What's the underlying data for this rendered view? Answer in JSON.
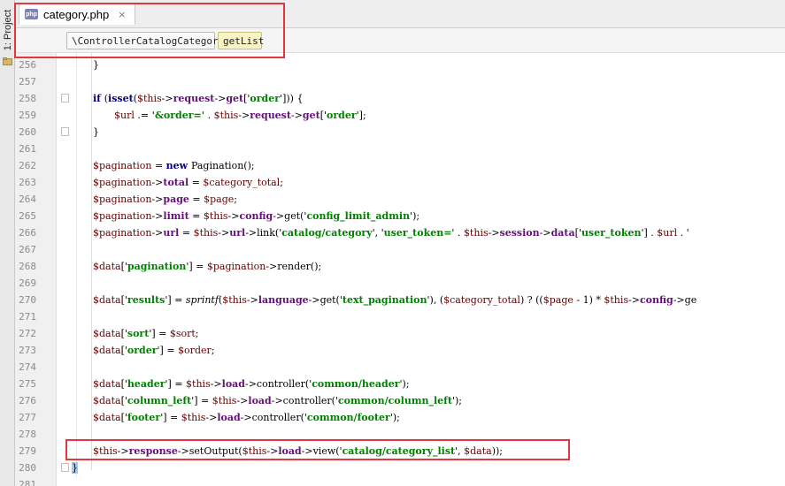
{
  "sidebar": {
    "tool_window_label": "1: Project"
  },
  "tab": {
    "filename": "category.php",
    "icon_text": "php",
    "close_glyph": "×"
  },
  "breadcrumb": {
    "class": "\\ControllerCatalogCategory",
    "method": "getList"
  },
  "editor": {
    "lines": [
      {
        "n": "256",
        "indent": 4,
        "tokens": [
          [
            "p",
            "}"
          ]
        ]
      },
      {
        "n": "257",
        "indent": 0,
        "tokens": []
      },
      {
        "n": "258",
        "indent": 4,
        "tokens": [
          [
            "kw",
            "if "
          ],
          [
            "p",
            "("
          ],
          [
            "kw",
            "isset"
          ],
          [
            "p",
            "("
          ],
          [
            "var",
            "$this"
          ],
          [
            "p",
            "->"
          ],
          [
            "prop",
            "request"
          ],
          [
            "p",
            "->"
          ],
          [
            "prop",
            "get"
          ],
          [
            "p",
            "['"
          ],
          [
            "str",
            "order"
          ],
          [
            "p",
            "'])) {"
          ]
        ]
      },
      {
        "n": "259",
        "indent": 8,
        "tokens": [
          [
            "var",
            "$url"
          ],
          [
            "p",
            " .= "
          ],
          [
            "str",
            "'&order='"
          ],
          [
            "p",
            " . "
          ],
          [
            "var",
            "$this"
          ],
          [
            "p",
            "->"
          ],
          [
            "prop",
            "request"
          ],
          [
            "p",
            "->"
          ],
          [
            "prop",
            "get"
          ],
          [
            "p",
            "['"
          ],
          [
            "str",
            "order"
          ],
          [
            "p",
            "'];"
          ]
        ]
      },
      {
        "n": "260",
        "indent": 4,
        "tokens": [
          [
            "p",
            "}"
          ]
        ]
      },
      {
        "n": "261",
        "indent": 0,
        "tokens": []
      },
      {
        "n": "262",
        "indent": 4,
        "tokens": [
          [
            "var",
            "$pagination"
          ],
          [
            "p",
            " = "
          ],
          [
            "kw",
            "new "
          ],
          [
            "p",
            "Pagination();"
          ]
        ]
      },
      {
        "n": "263",
        "indent": 4,
        "tokens": [
          [
            "var",
            "$pagination"
          ],
          [
            "p",
            "->"
          ],
          [
            "prop",
            "total"
          ],
          [
            "p",
            " = "
          ],
          [
            "var",
            "$category_total"
          ],
          [
            "p",
            ";"
          ]
        ]
      },
      {
        "n": "264",
        "indent": 4,
        "tokens": [
          [
            "var",
            "$pagination"
          ],
          [
            "p",
            "->"
          ],
          [
            "prop",
            "page"
          ],
          [
            "p",
            " = "
          ],
          [
            "var",
            "$page"
          ],
          [
            "p",
            ";"
          ]
        ]
      },
      {
        "n": "265",
        "indent": 4,
        "tokens": [
          [
            "var",
            "$pagination"
          ],
          [
            "p",
            "->"
          ],
          [
            "prop",
            "limit"
          ],
          [
            "p",
            " = "
          ],
          [
            "var",
            "$this"
          ],
          [
            "p",
            "->"
          ],
          [
            "prop",
            "config"
          ],
          [
            "p",
            "->get('"
          ],
          [
            "str",
            "config_limit_admin"
          ],
          [
            "p",
            "');"
          ]
        ]
      },
      {
        "n": "266",
        "indent": 4,
        "tokens": [
          [
            "var",
            "$pagination"
          ],
          [
            "p",
            "->"
          ],
          [
            "prop",
            "url"
          ],
          [
            "p",
            " = "
          ],
          [
            "var",
            "$this"
          ],
          [
            "p",
            "->"
          ],
          [
            "prop",
            "url"
          ],
          [
            "p",
            "->link('"
          ],
          [
            "str",
            "catalog/category"
          ],
          [
            "p",
            "', '"
          ],
          [
            "str",
            "user_token="
          ],
          [
            "p",
            "' . "
          ],
          [
            "var",
            "$this"
          ],
          [
            "p",
            "->"
          ],
          [
            "prop",
            "session"
          ],
          [
            "p",
            "->"
          ],
          [
            "prop",
            "data"
          ],
          [
            "p",
            "['"
          ],
          [
            "str",
            "user_token"
          ],
          [
            "p",
            "'] . "
          ],
          [
            "var",
            "$url"
          ],
          [
            "p",
            " . '"
          ]
        ]
      },
      {
        "n": "267",
        "indent": 0,
        "tokens": []
      },
      {
        "n": "268",
        "indent": 4,
        "tokens": [
          [
            "var",
            "$data"
          ],
          [
            "p",
            "['"
          ],
          [
            "str",
            "pagination"
          ],
          [
            "p",
            "'] = "
          ],
          [
            "var",
            "$pagination"
          ],
          [
            "p",
            "->render();"
          ]
        ]
      },
      {
        "n": "269",
        "indent": 0,
        "tokens": []
      },
      {
        "n": "270",
        "indent": 4,
        "tokens": [
          [
            "var",
            "$data"
          ],
          [
            "p",
            "['"
          ],
          [
            "str",
            "results"
          ],
          [
            "p",
            "'] = "
          ],
          [
            "it",
            "sprintf"
          ],
          [
            "p",
            "("
          ],
          [
            "var",
            "$this"
          ],
          [
            "p",
            "->"
          ],
          [
            "prop",
            "language"
          ],
          [
            "p",
            "->get('"
          ],
          [
            "str",
            "text_pagination"
          ],
          [
            "p",
            "'), ("
          ],
          [
            "var",
            "$category_total"
          ],
          [
            "p",
            ") ? (("
          ],
          [
            "var",
            "$page"
          ],
          [
            "p",
            " - 1) * "
          ],
          [
            "var",
            "$this"
          ],
          [
            "p",
            "->"
          ],
          [
            "prop",
            "config"
          ],
          [
            "p",
            "->ge"
          ]
        ]
      },
      {
        "n": "271",
        "indent": 0,
        "tokens": []
      },
      {
        "n": "272",
        "indent": 4,
        "tokens": [
          [
            "var",
            "$data"
          ],
          [
            "p",
            "['"
          ],
          [
            "str",
            "sort"
          ],
          [
            "p",
            "'] = "
          ],
          [
            "var",
            "$sort"
          ],
          [
            "p",
            ";"
          ]
        ]
      },
      {
        "n": "273",
        "indent": 4,
        "tokens": [
          [
            "var",
            "$data"
          ],
          [
            "p",
            "['"
          ],
          [
            "str",
            "order"
          ],
          [
            "p",
            "'] = "
          ],
          [
            "var",
            "$order"
          ],
          [
            "p",
            ";"
          ]
        ]
      },
      {
        "n": "274",
        "indent": 0,
        "tokens": []
      },
      {
        "n": "275",
        "indent": 4,
        "tokens": [
          [
            "var",
            "$data"
          ],
          [
            "p",
            "['"
          ],
          [
            "str",
            "header"
          ],
          [
            "p",
            "'] = "
          ],
          [
            "var",
            "$this"
          ],
          [
            "p",
            "->"
          ],
          [
            "prop",
            "load"
          ],
          [
            "p",
            "->controller('"
          ],
          [
            "str",
            "common/header"
          ],
          [
            "p",
            "');"
          ]
        ]
      },
      {
        "n": "276",
        "indent": 4,
        "tokens": [
          [
            "var",
            "$data"
          ],
          [
            "p",
            "['"
          ],
          [
            "str",
            "column_left"
          ],
          [
            "p",
            "'] = "
          ],
          [
            "var",
            "$this"
          ],
          [
            "p",
            "->"
          ],
          [
            "prop",
            "load"
          ],
          [
            "p",
            "->controller('"
          ],
          [
            "str",
            "common/column_left"
          ],
          [
            "p",
            "');"
          ]
        ]
      },
      {
        "n": "277",
        "indent": 4,
        "tokens": [
          [
            "var",
            "$data"
          ],
          [
            "p",
            "['"
          ],
          [
            "str",
            "footer"
          ],
          [
            "p",
            "'] = "
          ],
          [
            "var",
            "$this"
          ],
          [
            "p",
            "->"
          ],
          [
            "prop",
            "load"
          ],
          [
            "p",
            "->controller('"
          ],
          [
            "str",
            "common/footer"
          ],
          [
            "p",
            "');"
          ]
        ]
      },
      {
        "n": "278",
        "indent": 0,
        "tokens": []
      },
      {
        "n": "279",
        "indent": 4,
        "tokens": [
          [
            "var",
            "$this"
          ],
          [
            "p",
            "->"
          ],
          [
            "prop",
            "response"
          ],
          [
            "p",
            "->setOutput("
          ],
          [
            "var",
            "$this"
          ],
          [
            "p",
            "->"
          ],
          [
            "prop",
            "load"
          ],
          [
            "p",
            "->view('"
          ],
          [
            "str",
            "catalog/category_list"
          ],
          [
            "p",
            "', "
          ],
          [
            "var",
            "$data"
          ],
          [
            "p",
            "));"
          ]
        ]
      },
      {
        "n": "280",
        "indent": 0,
        "tokens": [
          [
            "hl",
            "}"
          ]
        ]
      },
      {
        "n": "281",
        "indent": 0,
        "tokens": []
      }
    ]
  }
}
